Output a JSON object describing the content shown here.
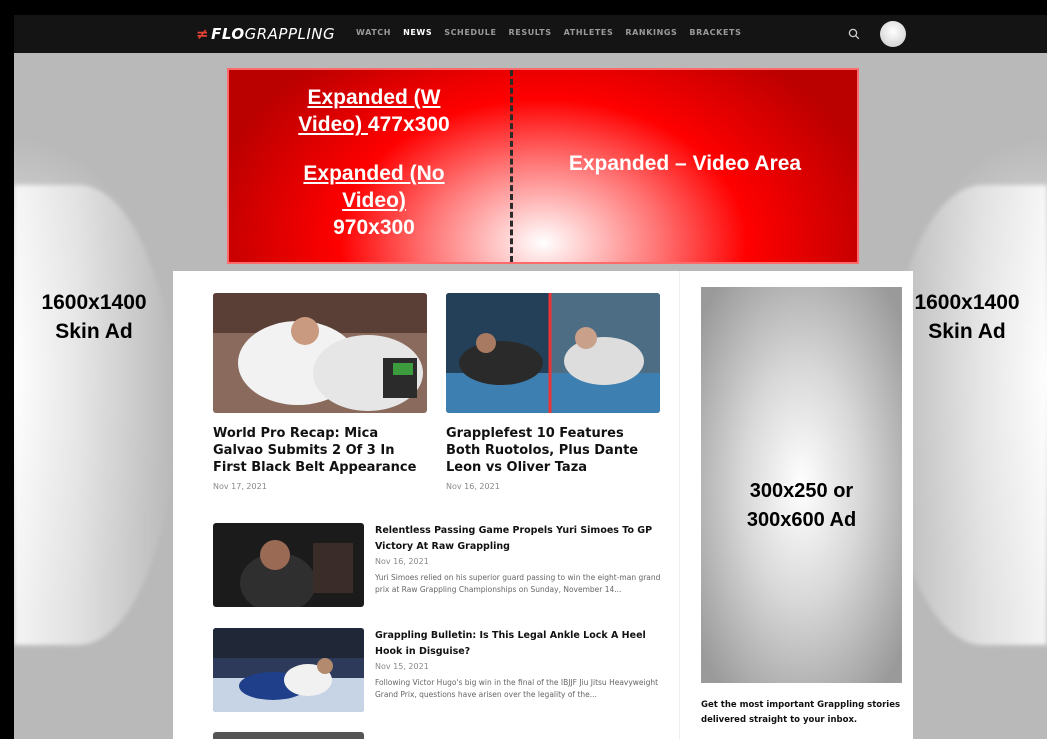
{
  "nav": {
    "logo_flo": "FLO",
    "logo_rest": "GRAPPLING",
    "items": [
      "WATCH",
      "NEWS",
      "SCHEDULE",
      "RESULTS",
      "ATHLETES",
      "RANKINGS",
      "BRACKETS"
    ],
    "active": "NEWS"
  },
  "banner": {
    "left_line1": "Expanded (W",
    "left_line2_u": "Video) ",
    "left_line2_rest": "477x300",
    "left_line3": "Expanded (No",
    "left_line4": "Video)",
    "left_line5": "970x300",
    "right_text": "Expanded – Video Area"
  },
  "skin": {
    "left_line1": "1600x1400",
    "left_line2": "Skin Ad",
    "right_line1": "1600x1400",
    "right_line2": "Skin Ad"
  },
  "cards": [
    {
      "title": "World Pro Recap: Mica Galvao Submits 2 Of 3 In First Black Belt Appearance",
      "date": "Nov 17, 2021"
    },
    {
      "title": "Grapplefest 10 Features Both Ruotolos, Plus Dante Leon vs Oliver Taza",
      "date": "Nov 16, 2021"
    }
  ],
  "list": [
    {
      "title": "Relentless Passing Game Propels Yuri Simoes To GP Victory At Raw Grappling",
      "date": "Nov 16, 2021",
      "summary": "Yuri Simoes relied on his superior guard passing to win the eight-man grand prix at Raw Grappling Championships on Sunday, November 14..."
    },
    {
      "title": "Grappling Bulletin: Is This Legal Ankle Lock A Heel Hook in Disguise?",
      "date": "Nov 15, 2021",
      "summary": "Following Victor Hugo's big win in the final of the IBJJF Jiu Jitsu Heavyweight Grand Prix, questions have arisen over the legality of the..."
    }
  ],
  "sidebar": {
    "ad_line1": "300x250 or",
    "ad_line2": "300x600 Ad",
    "newsletter": "Get the most important Grappling stories delivered straight to your inbox."
  },
  "colors": {
    "banner_red": "#ff0000",
    "nav_bg": "#141414",
    "logo_accent": "#e34234"
  }
}
